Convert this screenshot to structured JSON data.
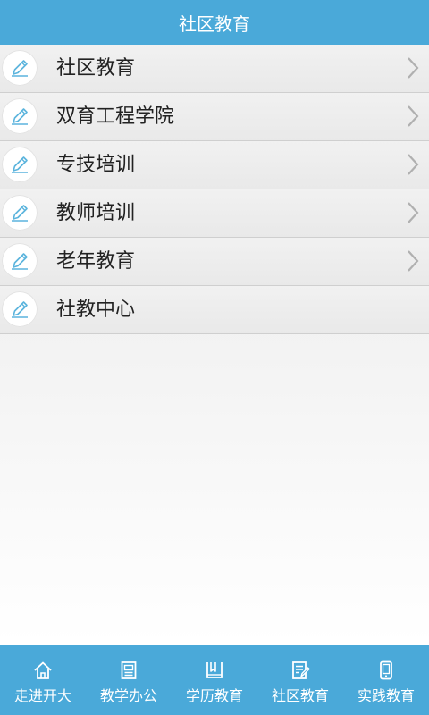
{
  "header": {
    "title": "社区教育"
  },
  "menu": {
    "items": [
      {
        "label": "社区教育",
        "has_arrow": true
      },
      {
        "label": "双育工程学院",
        "has_arrow": true
      },
      {
        "label": "专技培训",
        "has_arrow": true
      },
      {
        "label": "教师培训",
        "has_arrow": true
      },
      {
        "label": "老年教育",
        "has_arrow": true
      },
      {
        "label": "社教中心",
        "has_arrow": false
      }
    ],
    "icon": "pencil-icon"
  },
  "tabbar": {
    "tabs": [
      {
        "label": "走进开大",
        "icon": "home-icon"
      },
      {
        "label": "教学办公",
        "icon": "document-icon"
      },
      {
        "label": "学历教育",
        "icon": "book-icon"
      },
      {
        "label": "社区教育",
        "icon": "edit-note-icon"
      },
      {
        "label": "实践教育",
        "icon": "phone-icon"
      }
    ]
  },
  "colors": {
    "primary": "#4aa9d9",
    "row_bg": "#eeeeee",
    "text": "#222222",
    "icon_line": "#5bb4dd",
    "chevron": "#b0b0b0"
  }
}
